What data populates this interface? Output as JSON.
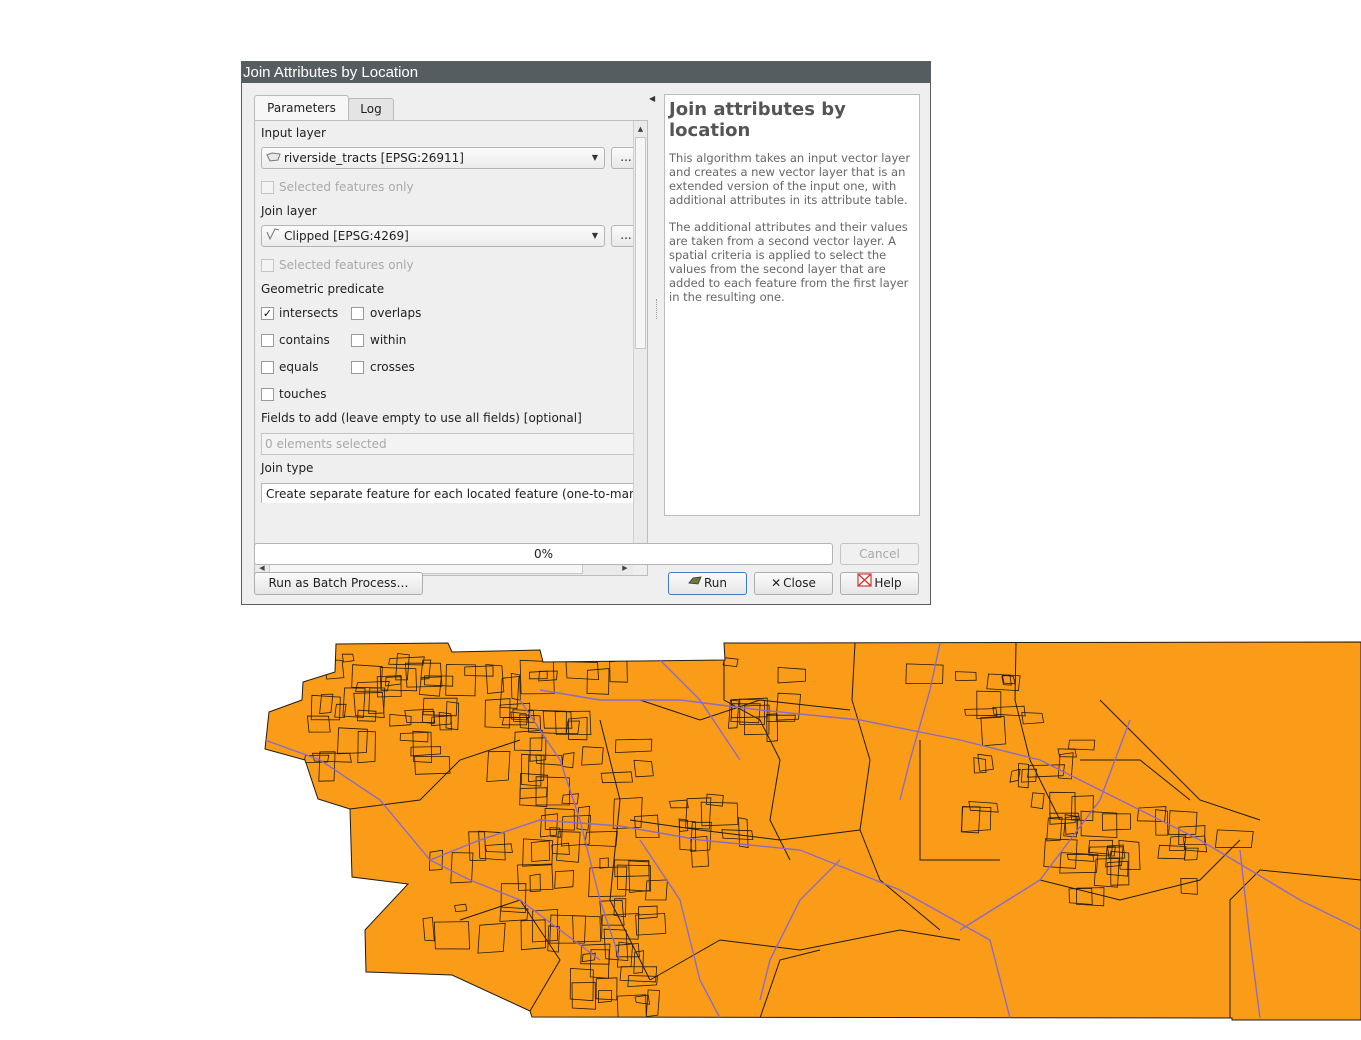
{
  "dialog": {
    "title": "Join Attributes by Location",
    "tabs": [
      "Parameters",
      "Log"
    ],
    "params": {
      "input_layer_label": "Input layer",
      "input_layer_value": "riverside_tracts [EPSG:26911]",
      "input_layer_icon": "polygon-layer-icon",
      "selected_only_label": "Selected features only",
      "join_layer_label": "Join layer",
      "join_layer_value": "Clipped [EPSG:4269]",
      "join_layer_icon": "line-layer-icon",
      "selected_only_label_2": "Selected features only",
      "predicate_label": "Geometric predicate",
      "predicates": [
        {
          "label": "intersects",
          "checked": true
        },
        {
          "label": "overlaps",
          "checked": false
        },
        {
          "label": "contains",
          "checked": false
        },
        {
          "label": "within",
          "checked": false
        },
        {
          "label": "equals",
          "checked": false
        },
        {
          "label": "crosses",
          "checked": false
        },
        {
          "label": "touches",
          "checked": false
        }
      ],
      "fields_label": "Fields to add (leave empty to use all fields) [optional]",
      "fields_value": "0 elements selected",
      "join_type_label": "Join type",
      "join_type_value": "Create separate feature for each located feature (one-to-many)",
      "browse_button": "..."
    },
    "help": {
      "title": "Join attributes by location",
      "paragraphs": [
        "This algorithm takes an input vector layer and creates a new vector layer that is an extended version of the input one, with additional attributes in its attribute table.",
        "The additional attributes and their values are taken from a second vector layer. A spatial criteria is applied to select the values from the second layer that are added to each feature from the first layer in the resulting one."
      ]
    },
    "progress": "0%",
    "buttons": {
      "cancel": "Cancel",
      "batch": "Run as Batch Process…",
      "run": "Run",
      "close": "Close",
      "help": "Help"
    }
  },
  "map": {
    "fill_color": "#fb9c19",
    "stroke_color": "#1f1a17",
    "road_color": "#8a6bc7"
  }
}
